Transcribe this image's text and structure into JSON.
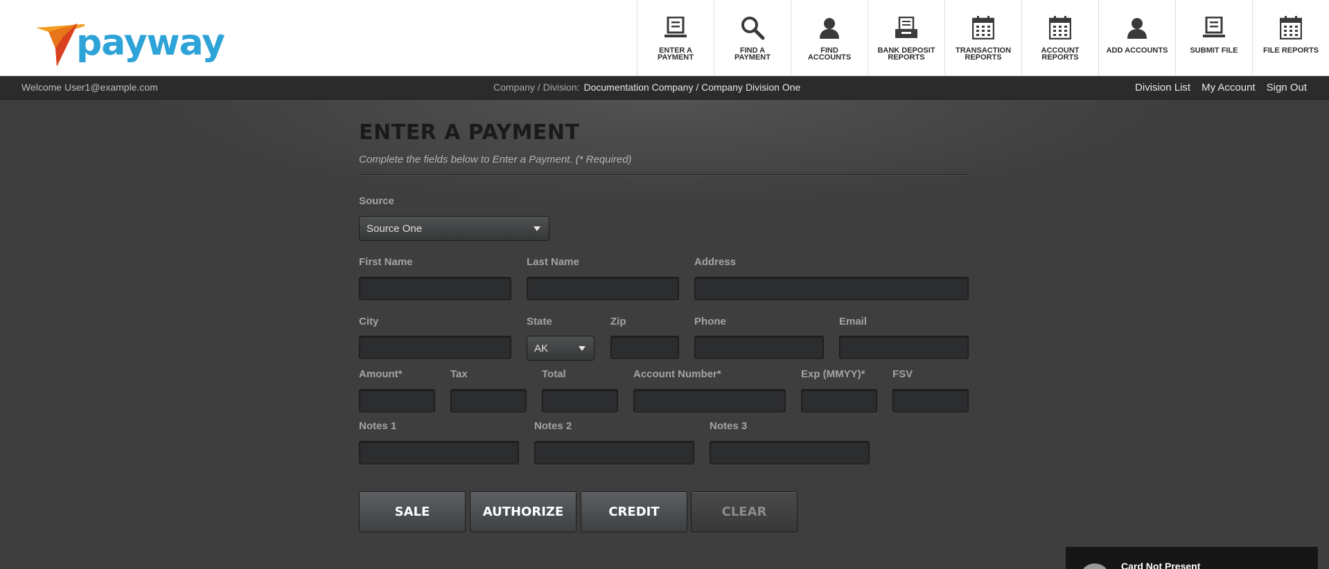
{
  "brand": {
    "name": "payway",
    "reg": "®",
    "primary_color": "#2ea3d8",
    "accent_color": "#f39a1f"
  },
  "nav": {
    "items": [
      {
        "icon": "document-icon",
        "label_line1": "ENTER A",
        "label_line2": "PAYMENT"
      },
      {
        "icon": "search-icon",
        "label_line1": "FIND A",
        "label_line2": "PAYMENT"
      },
      {
        "icon": "user-icon",
        "label_line1": "FIND",
        "label_line2": "ACCOUNTS"
      },
      {
        "icon": "deposit-tray-icon",
        "label_line1": "BANK DEPOSIT",
        "label_line2": "REPORTS"
      },
      {
        "icon": "calendar-icon",
        "label_line1": "TRANSACTION",
        "label_line2": "REPORTS"
      },
      {
        "icon": "calendar-icon",
        "label_line1": "ACCOUNT",
        "label_line2": "REPORTS"
      },
      {
        "icon": "user-icon",
        "label_line1": "ADD ACCOUNTS",
        "label_line2": ""
      },
      {
        "icon": "document-icon",
        "label_line1": "SUBMIT FILE",
        "label_line2": ""
      },
      {
        "icon": "calendar-icon",
        "label_line1": "FILE REPORTS",
        "label_line2": ""
      }
    ]
  },
  "status": {
    "welcome": "Welcome User1@example.com",
    "company_label": "Company / Division:",
    "company_value": "Documentation Company / Company Division One",
    "links": {
      "division_list": "Division List",
      "my_account": "My Account",
      "sign_out": "Sign Out"
    }
  },
  "form": {
    "title": "ENTER A PAYMENT",
    "subtitle": "Complete the fields below to Enter a Payment. (* Required)",
    "source": {
      "label": "Source",
      "value": "Source One"
    },
    "first_name": {
      "label": "First Name",
      "value": ""
    },
    "last_name": {
      "label": "Last Name",
      "value": ""
    },
    "address": {
      "label": "Address",
      "value": ""
    },
    "city": {
      "label": "City",
      "value": ""
    },
    "state": {
      "label": "State",
      "value": "AK"
    },
    "zip": {
      "label": "Zip",
      "value": ""
    },
    "phone": {
      "label": "Phone",
      "value": ""
    },
    "email": {
      "label": "Email",
      "value": ""
    },
    "amount": {
      "label": "Amount*",
      "value": ""
    },
    "tax": {
      "label": "Tax",
      "value": ""
    },
    "total": {
      "label": "Total",
      "value": ""
    },
    "account_number": {
      "label": "Account Number*",
      "value": ""
    },
    "exp": {
      "label": "Exp (MMYY)*",
      "value": ""
    },
    "fsv": {
      "label": "FSV",
      "value": ""
    },
    "notes1": {
      "label": "Notes 1",
      "value": ""
    },
    "notes2": {
      "label": "Notes 2",
      "value": ""
    },
    "notes3": {
      "label": "Notes 3",
      "value": ""
    }
  },
  "buttons": {
    "sale": "SALE",
    "authorize": "AUTHORIZE",
    "credit": "CREDIT",
    "clear": "CLEAR"
  },
  "widget": {
    "label": "Card Not Present"
  }
}
